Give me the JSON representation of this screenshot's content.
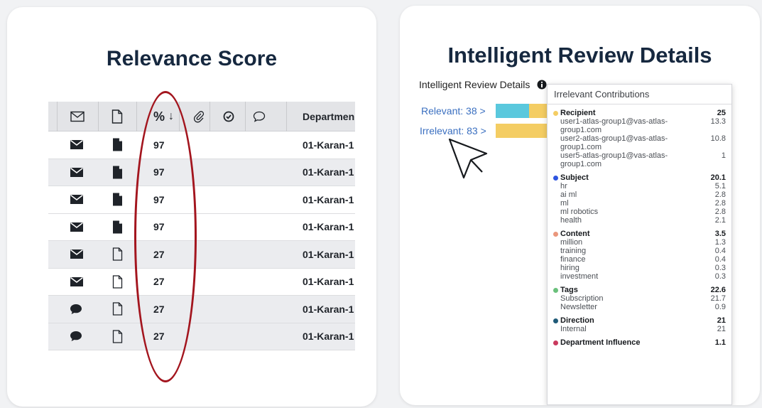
{
  "left_card": {
    "title": "Relevance Score",
    "table": {
      "header": {
        "percent_label": "%",
        "sort_arrow": "↓",
        "department_label": "Departmen",
        "icons": [
          "envelope-icon",
          "document-icon",
          "paperclip-icon",
          "check-circle-icon",
          "comment-icon"
        ]
      },
      "rows": [
        {
          "type_icon": "envelope-filled-icon",
          "doc_icon": "document-filled-icon",
          "score": "97",
          "department": "01-Karan-1",
          "shade": "white"
        },
        {
          "type_icon": "envelope-filled-icon",
          "doc_icon": "document-filled-icon",
          "score": "97",
          "department": "01-Karan-1",
          "shade": "shade"
        },
        {
          "type_icon": "envelope-filled-icon",
          "doc_icon": "document-filled-icon",
          "score": "97",
          "department": "01-Karan-1",
          "shade": "white"
        },
        {
          "type_icon": "envelope-filled-icon",
          "doc_icon": "document-filled-icon",
          "score": "97",
          "department": "01-Karan-1",
          "shade": "white"
        },
        {
          "type_icon": "envelope-filled-icon",
          "doc_icon": "document-outline-icon",
          "score": "27",
          "department": "01-Karan-1",
          "shade": "shade"
        },
        {
          "type_icon": "envelope-filled-icon",
          "doc_icon": "document-outline-icon",
          "score": "27",
          "department": "01-Karan-1",
          "shade": "white"
        },
        {
          "type_icon": "chat-bubble-icon",
          "doc_icon": "document-outline-icon",
          "score": "27",
          "department": "01-Karan-1",
          "shade": "shade"
        },
        {
          "type_icon": "chat-bubble-icon",
          "doc_icon": "document-outline-icon",
          "score": "27",
          "department": "01-Karan-1",
          "shade": "shade"
        }
      ]
    },
    "highlight_color": "#a3151e"
  },
  "right_card": {
    "title": "Intelligent Review Details",
    "section_label": "Intelligent Review Details",
    "relevant_link": "Relevant: 38 >",
    "irrelevant_link": "Irrelevant: 83 >",
    "relevant_bar": {
      "fraction_primary": 0.62,
      "primary_color": "#5ac8dd",
      "secondary_color": "#f4cd63"
    },
    "irrelevant_bar": {
      "fraction_primary": 1.0,
      "primary_color": "#f4cd63"
    },
    "popover": {
      "title": "Irrelevant Contributions",
      "categories": [
        {
          "name": "Recipient",
          "value": "25",
          "color": "#f4cd63",
          "items": [
            {
              "name": "user1-atlas-group1@vas-atlas-group1.com",
              "value": "13.3"
            },
            {
              "name": "user2-atlas-group1@vas-atlas-group1.com",
              "value": "10.8"
            },
            {
              "name": "user5-atlas-group1@vas-atlas-group1.com",
              "value": "1"
            }
          ]
        },
        {
          "name": "Subject",
          "value": "20.1",
          "color": "#2e55e0",
          "items": [
            {
              "name": "hr",
              "value": "5.1"
            },
            {
              "name": "ai ml",
              "value": "2.8"
            },
            {
              "name": "ml",
              "value": "2.8"
            },
            {
              "name": "ml robotics",
              "value": "2.8"
            },
            {
              "name": "health",
              "value": "2.1"
            }
          ]
        },
        {
          "name": "Content",
          "value": "3.5",
          "color": "#ea977c",
          "items": [
            {
              "name": "million",
              "value": "1.3"
            },
            {
              "name": "training",
              "value": "0.4"
            },
            {
              "name": "finance",
              "value": "0.4"
            },
            {
              "name": "hiring",
              "value": "0.3"
            },
            {
              "name": "investment",
              "value": "0.3"
            }
          ]
        },
        {
          "name": "Tags",
          "value": "22.6",
          "color": "#6ac07b",
          "items": [
            {
              "name": "Subscription",
              "value": "21.7"
            },
            {
              "name": "Newsletter",
              "value": "0.9"
            }
          ]
        },
        {
          "name": "Direction",
          "value": "21",
          "color": "#1f5a78",
          "items": [
            {
              "name": "Internal",
              "value": "21"
            }
          ]
        },
        {
          "name": "Department Influence",
          "value": "1.1",
          "color": "#c93a5e",
          "items": []
        }
      ]
    }
  }
}
